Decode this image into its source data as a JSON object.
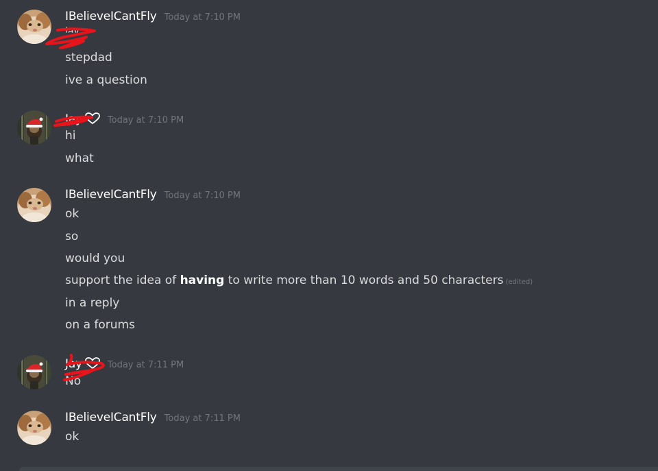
{
  "messages": [
    {
      "author": "IBelieveICantFly",
      "timestamp": "Today at 7:10 PM",
      "avatar_icon": "cat-avatar-icon",
      "lines": [
        "jay",
        "stepdad",
        "ive a question"
      ]
    },
    {
      "author": "Jay",
      "timestamp": "Today at 7:10 PM",
      "avatar_icon": "santa-hat-avatar-icon",
      "badge_icon": "heart-icon",
      "lines": [
        "hi",
        "what"
      ]
    },
    {
      "author": "IBelieveICantFly",
      "timestamp": "Today at 7:10 PM",
      "avatar_icon": "cat-avatar-icon",
      "lines": [
        "ok",
        "so",
        "would you",
        {
          "before": "support the idea of ",
          "bold": "having",
          "after": " to write more than 10 words and 50 characters",
          "edited": "(edited)"
        },
        "in a reply",
        "on a forums"
      ]
    },
    {
      "author": "Jay",
      "timestamp": "Today at 7:11 PM",
      "avatar_icon": "santa-hat-avatar-icon",
      "badge_icon": "heart-icon",
      "lines": [
        "No"
      ]
    },
    {
      "author": "IBelieveICantFly",
      "timestamp": "Today at 7:11 PM",
      "avatar_icon": "cat-avatar-icon",
      "lines": [
        "ok"
      ]
    }
  ],
  "colors": {
    "background": "#36393f",
    "username": "#ffffff",
    "message_text": "#dcddde",
    "timestamp": "#72767d",
    "redaction": "#e8141b"
  }
}
